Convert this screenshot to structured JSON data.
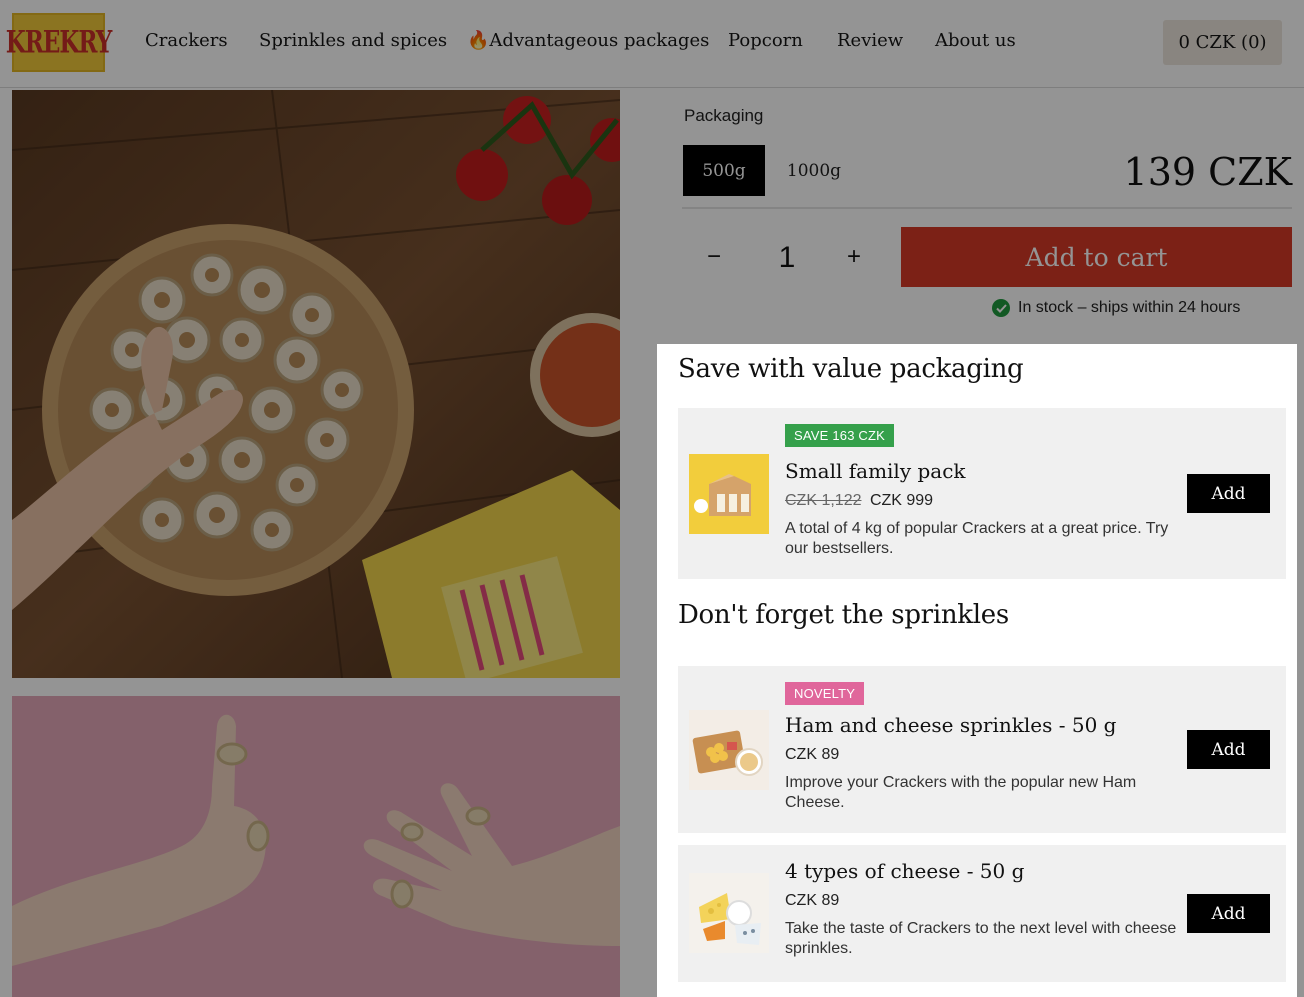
{
  "header": {
    "logo_text": "KREKRY",
    "nav": [
      {
        "label": "Crackers",
        "icon": ""
      },
      {
        "label": "Sprinkles and spices",
        "icon": ""
      },
      {
        "label": "Advantageous packages",
        "icon": "fire-icon"
      },
      {
        "label": "Popcorn",
        "icon": ""
      },
      {
        "label": "Review",
        "icon": ""
      },
      {
        "label": "About us",
        "icon": ""
      }
    ],
    "cart_label": "0 CZK (0)"
  },
  "product": {
    "packaging_label": "Packaging",
    "options": [
      "500g",
      "1000g"
    ],
    "selected_option": "500g",
    "price": "139 CZK",
    "quantity": "1",
    "minus_symbol": "−",
    "plus_symbol": "+",
    "add_to_cart_label": "Add to cart",
    "stock_text": "In stock – ships within 24 hours",
    "stock_color": "#1f9a3e",
    "add_to_cart_color": "#d63a27"
  },
  "upsell": {
    "value_title": "Save with value packaging",
    "value_items": [
      {
        "badge": "SAVE 163 CZK",
        "name": "Small family pack",
        "old_price": "CZK 1,122",
        "price": "CZK 999",
        "description": "A total of 4 kg of popular Crackers at a great price. Try our bestsellers.",
        "button": "Add"
      }
    ],
    "sprinkles_title": "Don't forget the sprinkles",
    "sprinkle_items": [
      {
        "badge": "NOVELTY",
        "name": "Ham and cheese sprinkles - 50 g",
        "price": "CZK 89",
        "description": "Improve your Crackers with the popular new Ham Cheese.",
        "button": "Add"
      },
      {
        "name": "4 types of cheese - 50 g",
        "price": "CZK 89",
        "description": "Take the taste of Crackers to the next level with cheese sprinkles.",
        "button": "Add"
      }
    ]
  }
}
